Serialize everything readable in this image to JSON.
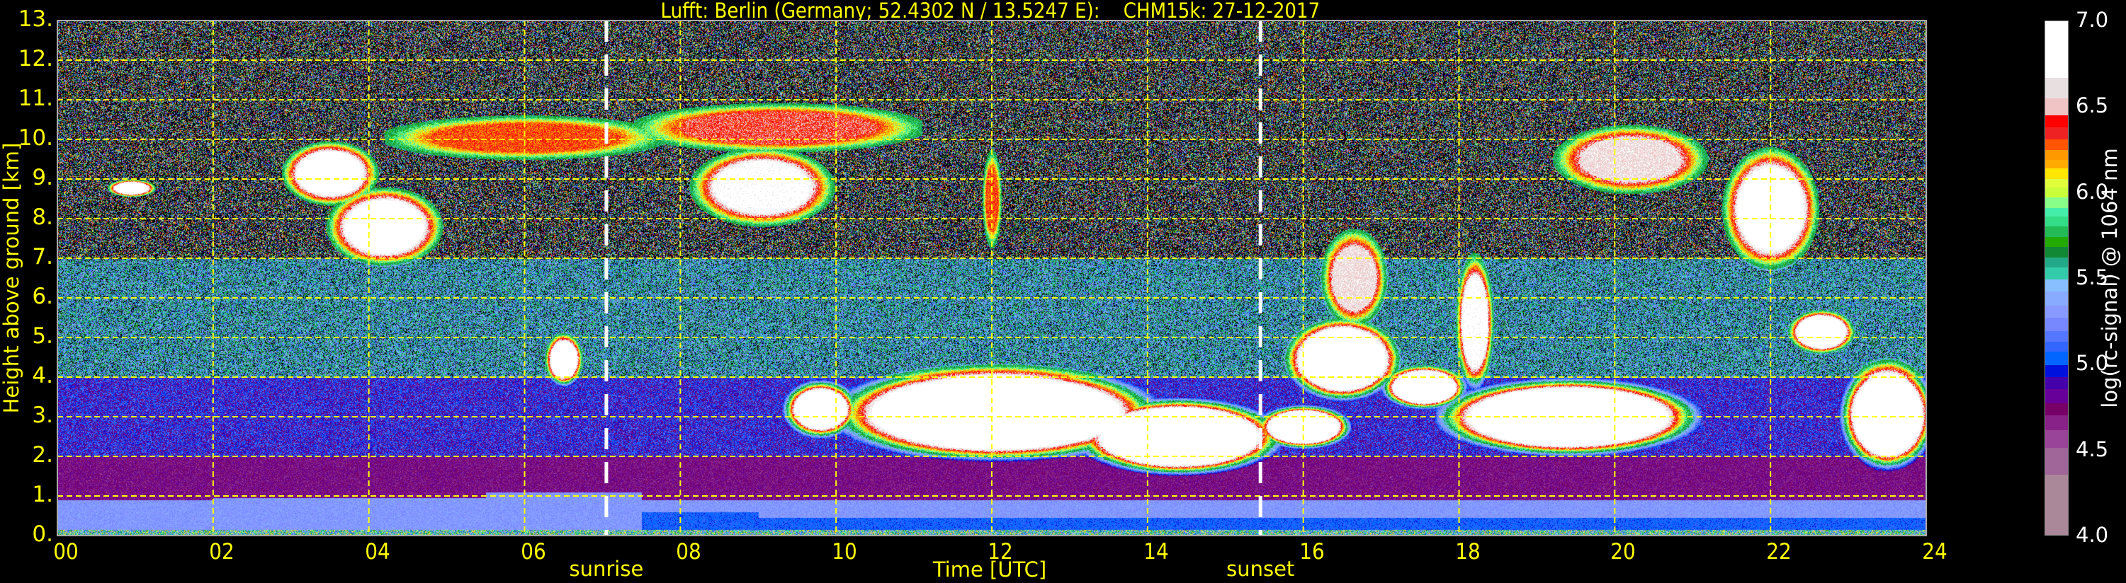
{
  "chart_data": {
    "type": "heatmap",
    "title": "Lufft: Berlin (Germany; 52.4302 N / 13.5247 E):    CHM15k: 27-12-2017",
    "xlabel": "Time [UTC]",
    "ylabel": "Height above ground [km]",
    "xlim": [
      0,
      24
    ],
    "ylim": [
      0,
      13
    ],
    "x_ticks": [
      "00",
      "02",
      "04",
      "06",
      "08",
      "10",
      "12",
      "14",
      "16",
      "18",
      "20",
      "22",
      "24"
    ],
    "y_ticks": [
      "0.",
      "1.",
      "2.",
      "3.",
      "4.",
      "5.",
      "6.",
      "7.",
      "8.",
      "9.",
      "10.",
      "11.",
      "12.",
      "13."
    ],
    "grid": true,
    "grid_color": "#ffff00",
    "events": [
      {
        "label": "sunrise",
        "time_h": 7.05
      },
      {
        "label": "sunset",
        "time_h": 15.45
      }
    ],
    "colorbar": {
      "label": "log(rc-signal) @ 1064 nm",
      "range": [
        4.0,
        7.0
      ],
      "ticks": [
        "4.0",
        "4.5",
        "5.0",
        "5.5",
        "6.0",
        "6.5",
        "7.0"
      ],
      "levels": [
        {
          "from": 4.0,
          "color": "#aa8899"
        },
        {
          "from": 4.35,
          "color": "#a06699"
        },
        {
          "from": 4.51,
          "color": "#994499"
        },
        {
          "from": 4.61,
          "color": "#882288"
        },
        {
          "from": 4.7,
          "color": "#770066"
        },
        {
          "from": 4.77,
          "color": "#660099"
        },
        {
          "from": 4.85,
          "color": "#4400aa"
        },
        {
          "from": 4.92,
          "color": "#0011dd"
        },
        {
          "from": 4.99,
          "color": "#0066ff"
        },
        {
          "from": 5.07,
          "color": "#3366ff"
        },
        {
          "from": 5.13,
          "color": "#5577ff"
        },
        {
          "from": 5.19,
          "color": "#7788ff"
        },
        {
          "from": 5.27,
          "color": "#8899ff"
        },
        {
          "from": 5.34,
          "color": "#88aaff"
        },
        {
          "from": 5.42,
          "color": "#88c0ff"
        },
        {
          "from": 5.49,
          "color": "#33ccaa"
        },
        {
          "from": 5.56,
          "color": "#22aa88"
        },
        {
          "from": 5.62,
          "color": "#118833"
        },
        {
          "from": 5.68,
          "color": "#22aa00"
        },
        {
          "from": 5.74,
          "color": "#22bb55"
        },
        {
          "from": 5.8,
          "color": "#33dd88"
        },
        {
          "from": 5.86,
          "color": "#44eeaa"
        },
        {
          "from": 5.91,
          "color": "#88ff88"
        },
        {
          "from": 5.97,
          "color": "#c8ff3a"
        },
        {
          "from": 6.03,
          "color": "#e0ff3a"
        },
        {
          "from": 6.08,
          "color": "#ffe600"
        },
        {
          "from": 6.14,
          "color": "#ffaa00"
        },
        {
          "from": 6.19,
          "color": "#ff9900"
        },
        {
          "from": 6.25,
          "color": "#ff5500"
        },
        {
          "from": 6.31,
          "color": "#ee2222"
        },
        {
          "from": 6.38,
          "color": "#ff0000"
        },
        {
          "from": 6.45,
          "color": "#f0c4c4"
        },
        {
          "from": 6.55,
          "color": "#e8e0e0"
        },
        {
          "from": 6.67,
          "color": "#ffffff"
        }
      ]
    },
    "background_profile": [
      {
        "h0": 0.0,
        "h1": 0.15,
        "value": 5.6,
        "noise": 0.6
      },
      {
        "h0": 0.15,
        "h1": 0.9,
        "value": 5.3,
        "noise": 0.08
      },
      {
        "h0": 0.9,
        "h1": 2.0,
        "value": 4.72,
        "noise": 0.12
      },
      {
        "h0": 2.0,
        "h1": 4.0,
        "value": 4.95,
        "noise": 0.25
      },
      {
        "h0": 4.0,
        "h1": 7.0,
        "value": 5.45,
        "noise": 0.45
      },
      {
        "h0": 7.0,
        "h1": 13.0,
        "value": 5.6,
        "noise": 0.9
      }
    ],
    "boundary_layer": [
      {
        "t0": 0,
        "t1": 2,
        "top_km": 0.7
      },
      {
        "t0": 2,
        "t1": 5.5,
        "top_km": 0.95
      },
      {
        "t0": 5.5,
        "t1": 7.5,
        "top_km": 1.1
      },
      {
        "t0": 7.5,
        "t1": 9,
        "top_km": 0.6
      },
      {
        "t0": 9,
        "t1": 24,
        "top_km": 0.45
      }
    ],
    "cloud_regions": [
      {
        "t0": 0.7,
        "t1": 1.2,
        "h0": 8.6,
        "h1": 8.95,
        "value": 6.9
      },
      {
        "t0": 3.0,
        "t1": 4.0,
        "h0": 8.5,
        "h1": 9.8,
        "value": 6.9
      },
      {
        "t0": 3.6,
        "t1": 4.8,
        "h0": 7.0,
        "h1": 8.6,
        "value": 6.9
      },
      {
        "t0": 4.5,
        "t1": 7.5,
        "h0": 9.6,
        "h1": 10.5,
        "value": 6.3
      },
      {
        "t0": 6.3,
        "t1": 6.7,
        "h0": 3.9,
        "h1": 5.0,
        "value": 6.9
      },
      {
        "t0": 7.7,
        "t1": 10.8,
        "h0": 9.8,
        "h1": 10.8,
        "value": 6.4
      },
      {
        "t0": 8.3,
        "t1": 9.8,
        "h0": 8.0,
        "h1": 9.6,
        "value": 6.8
      },
      {
        "t0": 9.4,
        "t1": 10.2,
        "h0": 2.6,
        "h1": 3.8,
        "value": 6.9
      },
      {
        "t0": 10.3,
        "t1": 13.8,
        "h0": 2.1,
        "h1": 4.1,
        "value": 7.4
      },
      {
        "t0": 11.9,
        "t1": 12.1,
        "h0": 7.5,
        "h1": 9.5,
        "value": 6.3
      },
      {
        "t0": 13.3,
        "t1": 15.5,
        "h0": 1.7,
        "h1": 3.3,
        "value": 7.4
      },
      {
        "t0": 15.5,
        "t1": 16.5,
        "h0": 2.3,
        "h1": 3.2,
        "value": 7.3
      },
      {
        "t0": 15.9,
        "t1": 17.1,
        "h0": 3.6,
        "h1": 5.3,
        "value": 7.3
      },
      {
        "t0": 16.3,
        "t1": 17.0,
        "h0": 5.5,
        "h1": 7.5,
        "value": 6.6
      },
      {
        "t0": 17.1,
        "t1": 18.0,
        "h0": 3.3,
        "h1": 4.2,
        "value": 7.2
      },
      {
        "t0": 18.0,
        "t1": 18.4,
        "h0": 4.0,
        "h1": 6.8,
        "value": 6.8
      },
      {
        "t0": 18.0,
        "t1": 20.8,
        "h0": 2.2,
        "h1": 3.8,
        "value": 7.4
      },
      {
        "t0": 19.4,
        "t1": 21.0,
        "h0": 8.8,
        "h1": 10.2,
        "value": 6.6
      },
      {
        "t0": 21.5,
        "t1": 22.5,
        "h0": 7.0,
        "h1": 9.5,
        "value": 6.9
      },
      {
        "t0": 22.3,
        "t1": 23.0,
        "h0": 4.7,
        "h1": 5.6,
        "value": 7.1
      },
      {
        "t0": 23.0,
        "t1": 24.0,
        "h0": 1.9,
        "h1": 4.2,
        "value": 7.2
      }
    ]
  }
}
